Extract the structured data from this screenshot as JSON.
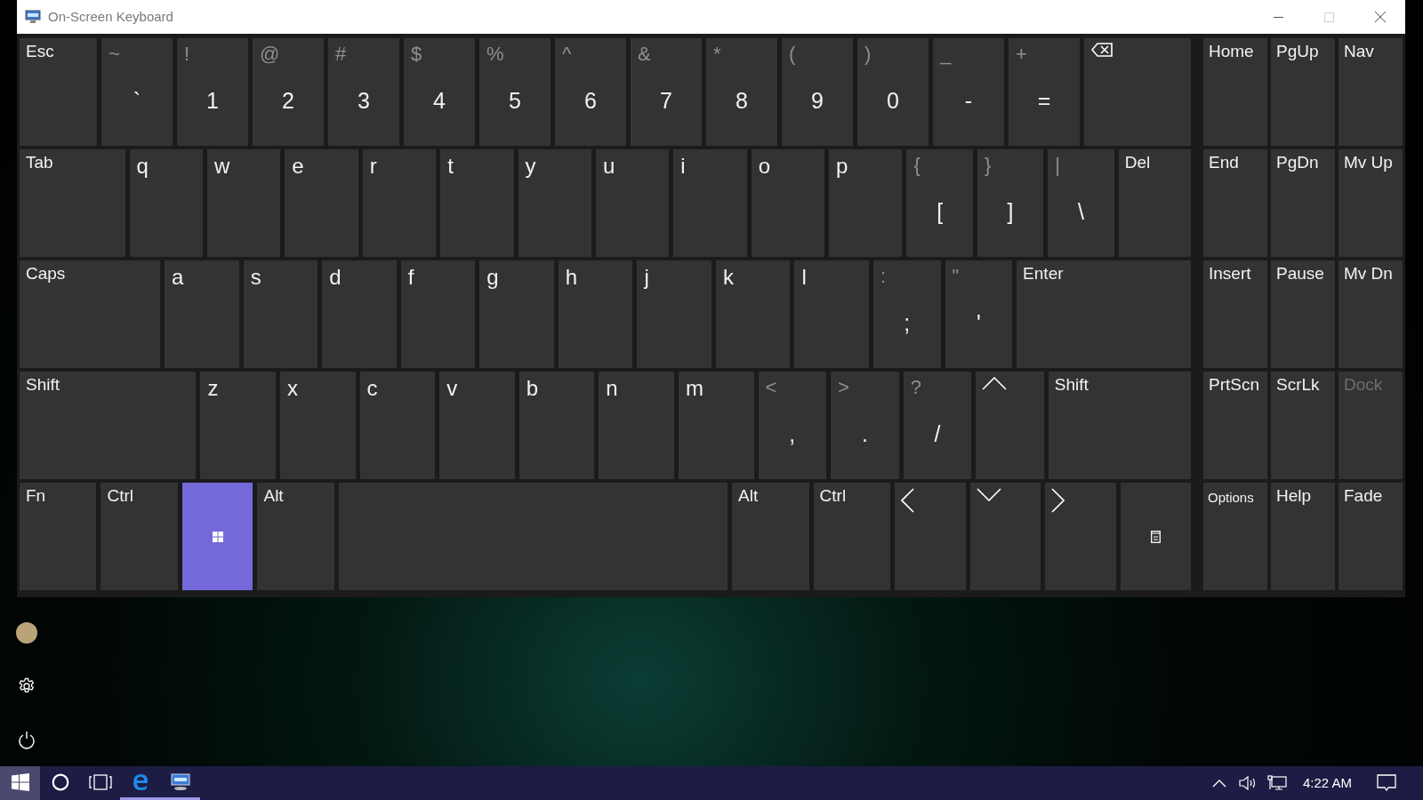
{
  "window": {
    "title": "On-Screen Keyboard",
    "caption_buttons": [
      {
        "kind": "minimize",
        "disabled": false
      },
      {
        "kind": "maximize",
        "disabled": true
      },
      {
        "kind": "close",
        "disabled": false
      }
    ]
  },
  "keyboard": {
    "rows": [
      {
        "keys": [
          {
            "kind": "func",
            "label": "Esc",
            "active": false
          },
          {
            "kind": "symbol",
            "shift": "~",
            "main": "`",
            "active": false
          },
          {
            "kind": "symbol",
            "shift": "!",
            "main": "1",
            "active": false
          },
          {
            "kind": "symbol",
            "shift": "@",
            "main": "2",
            "active": false
          },
          {
            "kind": "symbol",
            "shift": "#",
            "main": "3",
            "active": false
          },
          {
            "kind": "symbol",
            "shift": "$",
            "main": "4",
            "active": false
          },
          {
            "kind": "symbol",
            "shift": "%",
            "main": "5",
            "active": false
          },
          {
            "kind": "symbol",
            "shift": "^",
            "main": "6",
            "active": false
          },
          {
            "kind": "symbol",
            "shift": "&",
            "main": "7",
            "active": false
          },
          {
            "kind": "symbol",
            "shift": "*",
            "main": "8",
            "active": false
          },
          {
            "kind": "symbol",
            "shift": "(",
            "main": "9",
            "active": false
          },
          {
            "kind": "symbol",
            "shift": ")",
            "main": "0",
            "active": false
          },
          {
            "kind": "symbol",
            "shift": "_",
            "main": "-",
            "active": false
          },
          {
            "kind": "symbol",
            "shift": "+",
            "main": "=",
            "active": false
          },
          {
            "kind": "backspace",
            "active": false
          }
        ]
      },
      {
        "keys": [
          {
            "kind": "func",
            "label": "Tab",
            "active": false
          },
          {
            "kind": "letter",
            "label": "q",
            "active": false
          },
          {
            "kind": "letter",
            "label": "w",
            "active": false
          },
          {
            "kind": "letter",
            "label": "e",
            "active": false
          },
          {
            "kind": "letter",
            "label": "r",
            "active": false
          },
          {
            "kind": "letter",
            "label": "t",
            "active": false
          },
          {
            "kind": "letter",
            "label": "y",
            "active": false
          },
          {
            "kind": "letter",
            "label": "u",
            "active": false
          },
          {
            "kind": "letter",
            "label": "i",
            "active": false
          },
          {
            "kind": "letter",
            "label": "o",
            "active": false
          },
          {
            "kind": "letter",
            "label": "p",
            "active": false
          },
          {
            "kind": "symbol",
            "shift": "{",
            "main": "[",
            "active": false
          },
          {
            "kind": "symbol",
            "shift": "}",
            "main": "]",
            "active": false
          },
          {
            "kind": "symbol",
            "shift": "|",
            "main": "\\",
            "active": false
          },
          {
            "kind": "func",
            "label": "Del",
            "active": false
          }
        ]
      },
      {
        "keys": [
          {
            "kind": "func",
            "label": "Caps",
            "active": false
          },
          {
            "kind": "letter",
            "label": "a",
            "active": false
          },
          {
            "kind": "letter",
            "label": "s",
            "active": false
          },
          {
            "kind": "letter",
            "label": "d",
            "active": false
          },
          {
            "kind": "letter",
            "label": "f",
            "active": false
          },
          {
            "kind": "letter",
            "label": "g",
            "active": false
          },
          {
            "kind": "letter",
            "label": "h",
            "active": false
          },
          {
            "kind": "letter",
            "label": "j",
            "active": false
          },
          {
            "kind": "letter",
            "label": "k",
            "active": false
          },
          {
            "kind": "letter",
            "label": "l",
            "active": false
          },
          {
            "kind": "symbol",
            "shift": ":",
            "main": ";",
            "active": false
          },
          {
            "kind": "symbol",
            "shift": "\"",
            "main": "'",
            "active": false
          },
          {
            "kind": "func",
            "label": "Enter",
            "active": false
          }
        ]
      },
      {
        "keys": [
          {
            "kind": "func",
            "label": "Shift",
            "active": false
          },
          {
            "kind": "letter",
            "label": "z",
            "active": false
          },
          {
            "kind": "letter",
            "label": "x",
            "active": false
          },
          {
            "kind": "letter",
            "label": "c",
            "active": false
          },
          {
            "kind": "letter",
            "label": "v",
            "active": false
          },
          {
            "kind": "letter",
            "label": "b",
            "active": false
          },
          {
            "kind": "letter",
            "label": "n",
            "active": false
          },
          {
            "kind": "letter",
            "label": "m",
            "active": false
          },
          {
            "kind": "symbol",
            "shift": "<",
            "main": ",",
            "active": false
          },
          {
            "kind": "symbol",
            "shift": ">",
            "main": ".",
            "active": false
          },
          {
            "kind": "symbol",
            "shift": "?",
            "main": "/",
            "active": false
          },
          {
            "kind": "up",
            "active": false
          },
          {
            "kind": "func",
            "label": "Shift",
            "active": false
          }
        ]
      },
      {
        "keys": [
          {
            "kind": "func",
            "label": "Fn",
            "active": false
          },
          {
            "kind": "func",
            "label": "Ctrl",
            "active": false
          },
          {
            "kind": "windows",
            "active": true
          },
          {
            "kind": "func",
            "label": "Alt",
            "active": false
          },
          {
            "kind": "space",
            "active": false
          },
          {
            "kind": "func",
            "label": "Alt",
            "active": false
          },
          {
            "kind": "func",
            "label": "Ctrl",
            "active": false
          },
          {
            "kind": "left",
            "active": false
          },
          {
            "kind": "down",
            "active": false
          },
          {
            "kind": "right",
            "active": false
          },
          {
            "kind": "menu",
            "active": false
          }
        ]
      }
    ],
    "nav_keys": [
      {
        "kind": "func",
        "label": "Home",
        "disabled": false
      },
      {
        "kind": "func",
        "label": "PgUp",
        "disabled": false
      },
      {
        "kind": "func",
        "label": "Nav",
        "disabled": false
      },
      {
        "kind": "func",
        "label": "End",
        "disabled": false
      },
      {
        "kind": "func",
        "label": "PgDn",
        "disabled": false
      },
      {
        "kind": "func",
        "label": "Mv Up",
        "disabled": false
      },
      {
        "kind": "func",
        "label": "Insert",
        "disabled": false
      },
      {
        "kind": "func",
        "label": "Pause",
        "disabled": false
      },
      {
        "kind": "func",
        "label": "Mv Dn",
        "disabled": false
      },
      {
        "kind": "func",
        "label": "PrtScn",
        "disabled": false
      },
      {
        "kind": "func",
        "label": "ScrLk",
        "disabled": false
      },
      {
        "kind": "func",
        "label": "Dock",
        "disabled": true
      },
      {
        "kind": "small",
        "label": "Options",
        "disabled": false
      },
      {
        "kind": "func",
        "label": "Help",
        "disabled": false
      },
      {
        "kind": "func",
        "label": "Fade",
        "disabled": false
      }
    ]
  },
  "taskbar": {
    "buttons": [
      {
        "kind": "start",
        "active": true,
        "running": false
      },
      {
        "kind": "cortana",
        "active": false,
        "running": false
      },
      {
        "kind": "taskview",
        "active": false,
        "running": false
      },
      {
        "kind": "browser",
        "active": false,
        "running": true
      },
      {
        "kind": "keyboard",
        "active": false,
        "running": true
      }
    ],
    "clock": "4:22 AM"
  }
}
